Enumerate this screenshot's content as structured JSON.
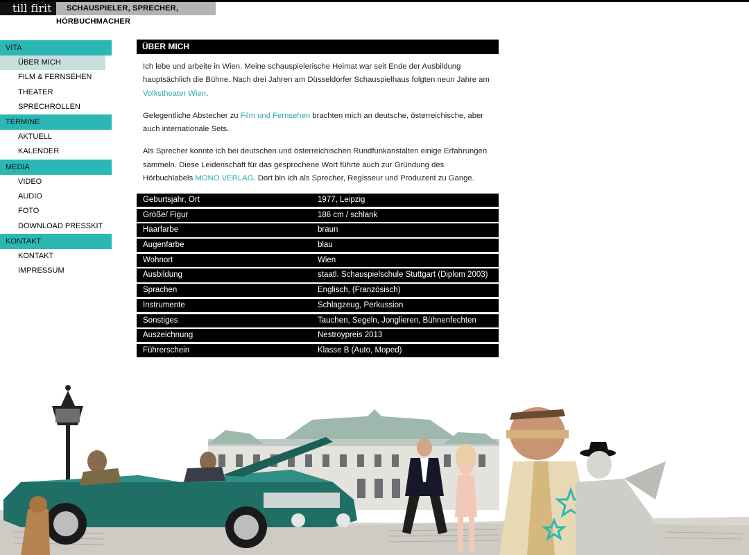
{
  "header": {
    "logo": "till firit",
    "tagline": "SCHAUSPIELER, SPRECHER, HÖRBUCHMACHER"
  },
  "nav": {
    "sections": [
      {
        "title": "VITA",
        "items": [
          "ÜBER MICH",
          "FILM & FERNSEHEN",
          "THEATER",
          "SPRECHROLLEN"
        ]
      },
      {
        "title": "TERMINE",
        "items": [
          "AKTUELL",
          "KALENDER"
        ]
      },
      {
        "title": "MEDIA",
        "items": [
          "VIDEO",
          "AUDIO",
          "FOTO",
          "DOWNLOAD PRESSKIT"
        ]
      },
      {
        "title": "KONTAKT",
        "items": [
          "KONTAKT",
          "IMPRESSUM"
        ]
      }
    ],
    "active_item": "ÜBER MICH"
  },
  "main": {
    "title": "ÜBER MICH",
    "p1_text": "Ich lebe und arbeite in Wien. Meine schauspielerische Heimat war seit Ende der Ausbildung hauptsächlich die Bühne. Nach drei Jahren am Düsseldorfer Schauspielhaus folgten neun Jahre am ",
    "p1_link": "Volkstheater Wien",
    "p1_end": ".",
    "p2_start": "Gelegentliche Abstecher zu ",
    "p2_link": "Film und Fernsehen",
    "p2_end": " brachten mich an deutsche, österreichische, aber auch internationale Sets.",
    "p3_text": "Als Sprecher konnte ich bei deutschen und österreichischen Rundfunkanstalten einige Erfahrungen sammeln. Diese Leidenschaft für das gesprochene Wort führte auch zur Gründung des Hörbuchlabels ",
    "p3_link": "MONO VERLAG",
    "p3_end": ". Dort bin ich als Sprecher, Regisseur und Produzent zu Gange."
  },
  "facts": [
    {
      "label": "Geburtsjahr, Ort",
      "value": "1977, Leipzig"
    },
    {
      "label": "Größe/ Figur",
      "value": "186 cm / schlank"
    },
    {
      "label": "Haarfarbe",
      "value": "braun"
    },
    {
      "label": "Augenfarbe",
      "value": "blau"
    },
    {
      "label": "Wohnort",
      "value": "Wien"
    },
    {
      "label": "Ausbildung",
      "value": "staatl. Schauspielschule Stuttgart (Diplom 2003)"
    },
    {
      "label": "Sprachen",
      "value": "Englisch, (Französisch)"
    },
    {
      "label": "Instrumente",
      "value": "Schlagzeug, Perkussion"
    },
    {
      "label": "Sonstiges",
      "value": "Tauchen, Segeln, Jonglieren, Bühnenfechten"
    },
    {
      "label": "Auszeichnung",
      "value": "Nestroypreis 2013"
    },
    {
      "label": "Führerschein",
      "value": "Klasse B (Auto, Moped)"
    }
  ],
  "colors": {
    "accent": "#2bb7b3",
    "link": "#2aa7a3",
    "active_bg": "#c8dfde",
    "car": "#1f6f66"
  }
}
